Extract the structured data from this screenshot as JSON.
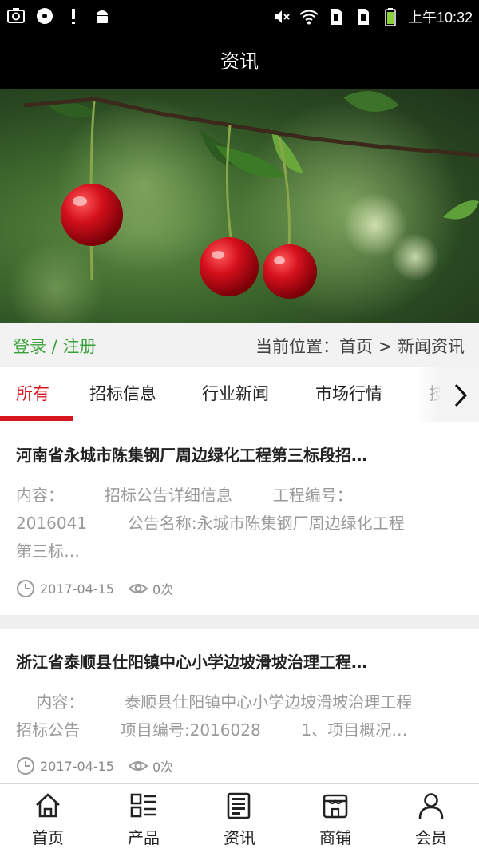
{
  "status_bar": {
    "time": "上午10:32",
    "icons_left": [
      "screenshot-icon",
      "media-icon",
      "notice-icon",
      "android-icon"
    ],
    "icons_right": [
      "mute-icon",
      "wifi-icon",
      "sim1-icon",
      "sim2-icon",
      "battery-icon"
    ]
  },
  "header": {
    "title": "资讯"
  },
  "banner": {
    "image": "cherries-branch"
  },
  "infobar": {
    "login": "登录",
    "separator": " / ",
    "register": "注册",
    "breadcrumb_prefix": "当前位置：",
    "breadcrumb_home": "首页",
    "breadcrumb_arrow": " > ",
    "breadcrumb_current": "新闻资讯"
  },
  "tabs": [
    {
      "label": "所有",
      "active": true
    },
    {
      "label": "招标信息",
      "active": false
    },
    {
      "label": "行业新闻",
      "active": false
    },
    {
      "label": "市场行情",
      "active": false
    },
    {
      "label": "技",
      "active": false
    }
  ],
  "articles": [
    {
      "title": "河南省永城市陈集钢厂周边绿化工程第三标段招…",
      "body_lines": [
        "内容：        招标公告详细信息        工程编号：",
        "2016041        公告名称:永城市陈集钢厂周边绿化工程",
        "第三标…"
      ],
      "date": "2017-04-15",
      "views": "0次"
    },
    {
      "title": "浙江省泰顺县仕阳镇中心小学边坡滑坡治理工程…",
      "body_lines": [
        "    内容：        泰顺县仕阳镇中心小学边坡滑坡治理工程",
        "招标公告        项目编号:2016028        1、项目概况…"
      ],
      "date": "2017-04-15",
      "views": "0次"
    }
  ],
  "bottom_nav": [
    {
      "label": "首页",
      "icon": "home-icon"
    },
    {
      "label": "产品",
      "icon": "grid-list-icon"
    },
    {
      "label": "资讯",
      "icon": "news-icon"
    },
    {
      "label": "商铺",
      "icon": "shop-icon"
    },
    {
      "label": "会员",
      "icon": "user-icon"
    }
  ],
  "colors": {
    "accent": "#d9161f",
    "link_green": "#3aa13a",
    "bar_bg": "#000000"
  }
}
